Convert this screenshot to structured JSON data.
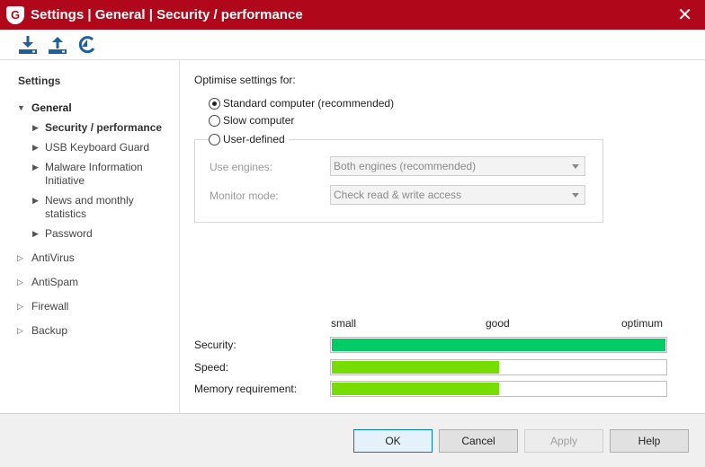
{
  "window": {
    "title": "Settings | General | Security / performance",
    "logo_letter": "G"
  },
  "toolbar": {
    "buttons": [
      "download-icon",
      "upload-icon",
      "restore-icon"
    ]
  },
  "sidebar": {
    "heading": "Settings",
    "general": "General",
    "general_children": [
      "Security / performance",
      "USB Keyboard Guard",
      "Malware Information Initiative",
      "News and monthly statistics",
      "Password"
    ],
    "others": [
      "AntiVirus",
      "AntiSpam",
      "Firewall",
      "Backup"
    ]
  },
  "content": {
    "optimise_label": "Optimise settings for:",
    "radios": [
      "Standard computer (recommended)",
      "Slow computer",
      "User-defined"
    ],
    "selected_radio": 0,
    "use_engines_label": "Use engines:",
    "use_engines_value": "Both engines (recommended)",
    "monitor_mode_label": "Monitor mode:",
    "monitor_mode_value": "Check read & write access",
    "scale": [
      "small",
      "good",
      "optimum"
    ],
    "meters": [
      {
        "label": "Security:",
        "level": 1.0,
        "color": "#00cc66"
      },
      {
        "label": "Speed:",
        "level": 0.5,
        "color": "#77dd00"
      },
      {
        "label": "Memory requirement:",
        "level": 0.5,
        "color": "#77dd00"
      }
    ]
  },
  "footer": {
    "ok": "OK",
    "cancel": "Cancel",
    "apply": "Apply",
    "help": "Help"
  },
  "colors": {
    "titlebar": "#b0081a",
    "toolbar_icons": "#1f5f9e"
  }
}
